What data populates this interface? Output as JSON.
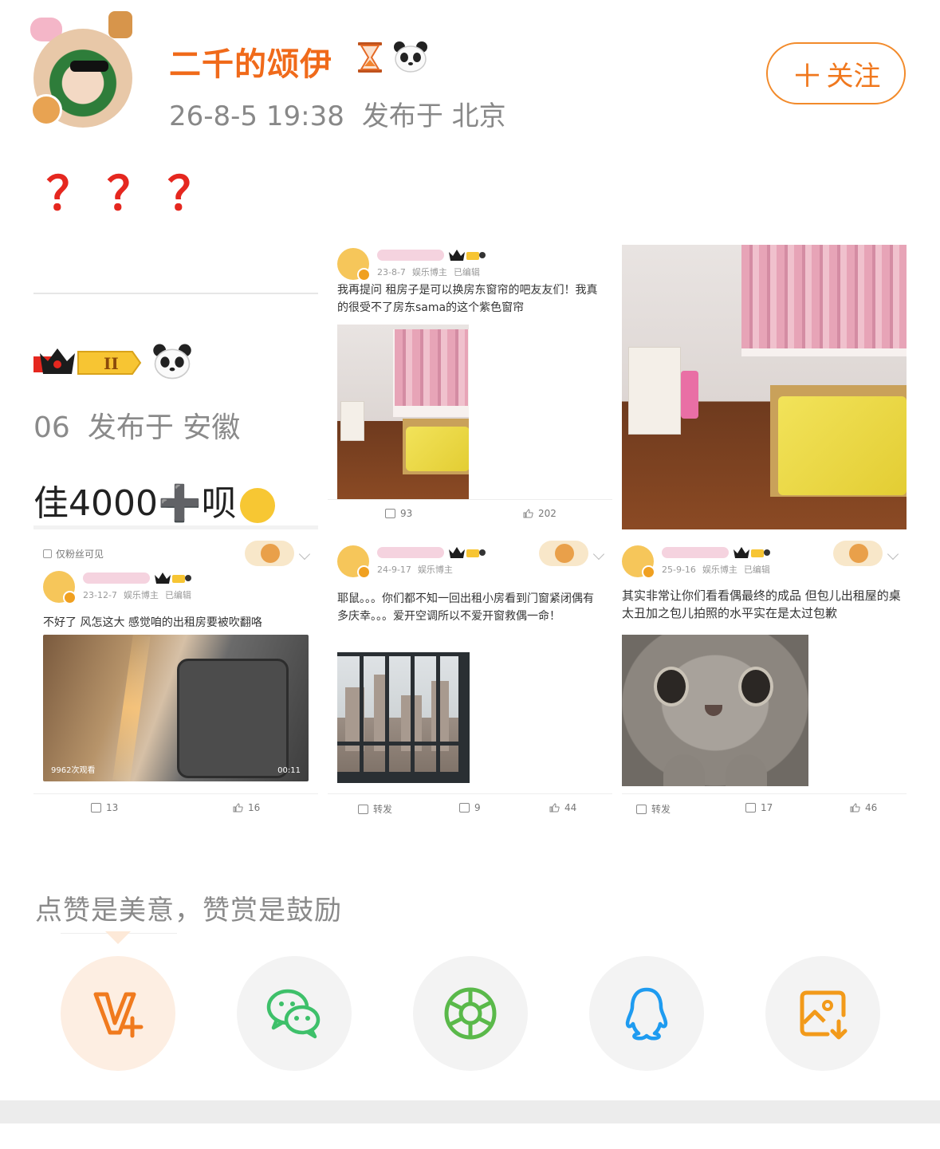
{
  "post": {
    "author": "二千的颂伊",
    "timestamp": "26-8-5 19:38",
    "location": "发布于 北京",
    "follow_label": "关注",
    "follow_plus": "＋",
    "text": "？？？"
  },
  "images": {
    "crop": {
      "meta_date": "06",
      "meta_location": "发布于 安徽",
      "text": "佳4000➕呗"
    },
    "repost_curtain": {
      "date": "23-8-7",
      "tag": "娱乐博主",
      "edited": "已编辑",
      "text": "我再提问 租房子是可以换房东窗帘的吧友友们！我真的很受不了房东sama的这个紫色窗帘",
      "comments": "93",
      "likes": "202"
    },
    "repost_wind": {
      "privacy": "仅粉丝可见",
      "date": "23-12-7",
      "tag": "娱乐博主",
      "edited": "已编辑",
      "text": "不好了 风怎这大 感觉咱的出租房要被吹翻咯",
      "views": "9962次观看",
      "duration": "00:11",
      "comments": "13",
      "likes": "16"
    },
    "repost_window": {
      "date": "24-9-17",
      "tag": "娱乐博主",
      "text": "耶鼠。。。你们都不知一回出租小房看到门窗紧闭偶有多庆幸。。。爱开空调所以不爱开窗救偶一命！",
      "share": "转发",
      "comments": "9",
      "likes": "44"
    },
    "repost_cat": {
      "date": "25-9-16",
      "tag": "娱乐博主",
      "edited": "已编辑",
      "text": "其实非常让你们看看偶最终的成品 但包儿出租屋的桌太丑加之包儿拍照的水平实在是太过包歉",
      "share": "转发",
      "comments": "17",
      "likes": "46"
    }
  },
  "reward": {
    "text": "点赞是美意，赞赏是鼓励"
  },
  "share_icons": [
    "v-plus-icon",
    "wechat-icon",
    "moments-icon",
    "qq-icon",
    "save-image-icon"
  ],
  "colors": {
    "accent": "#f06a1a",
    "question_marks": "#e5271f",
    "wechat": "#3ec06a",
    "moments": "#5ab94a",
    "qq": "#1e9bf0",
    "save": "#f29a1a"
  }
}
